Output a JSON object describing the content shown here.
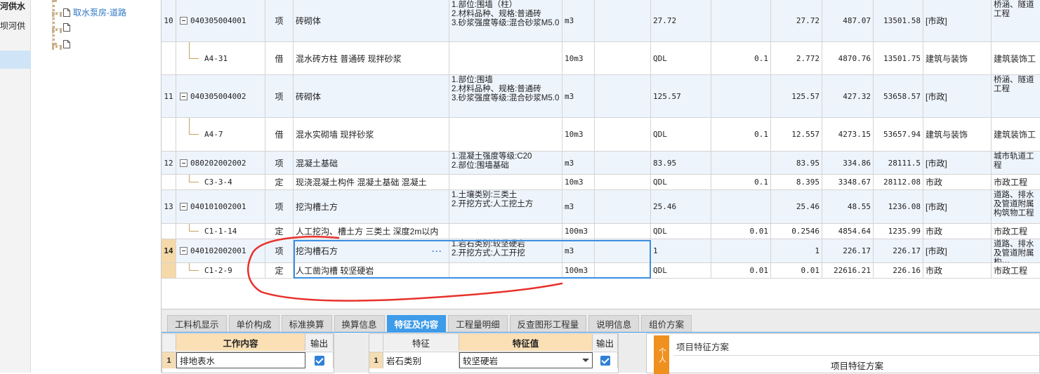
{
  "left_strip": {
    "line1": "河供水",
    "line2": "坝河供"
  },
  "tree": {
    "nodes": [
      {
        "label": "取水泵房-道路"
      },
      {
        "label": ""
      },
      {
        "label": ""
      }
    ]
  },
  "grid": {
    "rows": [
      {
        "kind": "item",
        "seq": "10",
        "code": "040305004001",
        "type": "项",
        "name": "砖砌体",
        "feature": "1.部位:围墙（柱）\n2.材料品种、规格:普通砖\n3.砂浆强度等级:混合砂浆M5.0",
        "unit": "m3",
        "expr": "",
        "qty_expr": "27.72",
        "coef": "",
        "qty": "27.72",
        "price": "487.07",
        "total": "13501.58",
        "major": "[市政]",
        "remark": "桥涵、隧道工程"
      },
      {
        "kind": "sub",
        "seq": "",
        "code": "A4-31",
        "type": "借",
        "name": "混水砖方柱 普通砖 现拌砂浆",
        "feature": "",
        "unit": "10m3",
        "expr": "",
        "qty_expr": "QDL",
        "coef": "0.1",
        "qty": "2.772",
        "price": "4870.76",
        "total": "13501.75",
        "major": "建筑与装饰",
        "remark": "建筑装饰工"
      },
      {
        "kind": "item",
        "seq": "11",
        "code": "040305004002",
        "type": "项",
        "name": "砖砌体",
        "feature": "1.部位:围墙\n2.材料品种、规格:普通砖\n3.砂浆强度等级:混合砂浆M5.0",
        "unit": "m3",
        "expr": "",
        "qty_expr": "125.57",
        "coef": "",
        "qty": "125.57",
        "price": "427.32",
        "total": "53658.57",
        "major": "[市政]",
        "remark": "桥涵、隧道工程"
      },
      {
        "kind": "sub",
        "seq": "",
        "code": "A4-7",
        "type": "借",
        "name": "混水实砌墙 现拌砂浆",
        "feature": "",
        "unit": "10m3",
        "expr": "",
        "qty_expr": "QDL",
        "coef": "0.1",
        "qty": "12.557",
        "price": "4273.15",
        "total": "53657.94",
        "major": "建筑与装饰",
        "remark": "建筑装饰工"
      },
      {
        "kind": "item",
        "seq": "12",
        "code": "080202002002",
        "type": "项",
        "name": "混凝土基础",
        "feature": "1.混凝土强度等级:C20\n2.部位:围墙基础",
        "unit": "m3",
        "expr": "",
        "qty_expr": "83.95",
        "coef": "",
        "qty": "83.95",
        "price": "334.86",
        "total": "28111.5",
        "major": "[市政]",
        "remark": "城市轨道工程"
      },
      {
        "kind": "sub",
        "seq": "",
        "code": "C3-3-4",
        "type": "定",
        "name": "现浇混凝土构件 混凝土基础 混凝土",
        "feature": "",
        "unit": "10m3",
        "expr": "",
        "qty_expr": "QDL",
        "coef": "0.1",
        "qty": "8.395",
        "price": "3348.67",
        "total": "28112.08",
        "major": "市政",
        "remark": "市政工程"
      },
      {
        "kind": "item",
        "seq": "13",
        "code": "040101002001",
        "type": "项",
        "name": "挖沟槽土方",
        "feature": "1.土壤类别:三类土\n2.开挖方式:人工挖土方",
        "unit": "m3",
        "expr": "",
        "qty_expr": "25.46",
        "coef": "",
        "qty": "25.46",
        "price": "48.55",
        "total": "1236.08",
        "major": "[市政]",
        "remark": "道路、排水及管道附属构筑物工程"
      },
      {
        "kind": "sub",
        "seq": "",
        "code": "C1-1-14",
        "type": "定",
        "name": "人工挖沟、槽土方 三类土 深度2m以内",
        "feature": "",
        "unit": "100m3",
        "expr": "",
        "qty_expr": "QDL",
        "coef": "0.01",
        "qty": "0.2546",
        "price": "4854.64",
        "total": "1235.99",
        "major": "市政",
        "remark": "市政工程"
      },
      {
        "kind": "item",
        "seq": "14",
        "code": "040102002001",
        "type": "项",
        "name": "挖沟槽石方",
        "feature": "1.岩石类别:较坚硬岩\n2.开挖方式:人工开挖",
        "unit": "m3",
        "expr": "",
        "qty_expr": "1",
        "coef": "",
        "qty": "1",
        "price": "226.17",
        "total": "226.17",
        "major": "[市政]",
        "remark": "道路、排水及管道附属构···"
      },
      {
        "kind": "sub",
        "seq": "",
        "code": "C1-2-9",
        "type": "定",
        "name": "人工凿沟槽 较坚硬岩",
        "feature": "",
        "unit": "100m3",
        "expr": "",
        "qty_expr": "QDL",
        "coef": "0.01",
        "qty": "0.01",
        "price": "22616.21",
        "total": "226.16",
        "major": "市政",
        "remark": "市政工程"
      }
    ],
    "more_indicator": "···"
  },
  "bottom": {
    "tabs": [
      "工料机显示",
      "单价构成",
      "标准换算",
      "换算信息",
      "特征及内容",
      "工程量明细",
      "反查图形工程量",
      "说明信息",
      "组价方案"
    ],
    "active_tab": "特征及内容",
    "work": {
      "headers": [
        "工作内容",
        "输出"
      ],
      "rows": [
        {
          "idx": "1",
          "content": "排地表水"
        }
      ]
    },
    "feature": {
      "headers": [
        "特征",
        "特征值",
        "输出"
      ],
      "rows": [
        {
          "idx": "1",
          "name": "岩石类别",
          "value": "较坚硬岩"
        }
      ]
    },
    "scheme": {
      "vtab": "个人",
      "title": "项目特征方案",
      "column": "项目特征方案"
    }
  },
  "colors": {
    "accent": "#3d9be9",
    "selection_border": "#3b8ee0",
    "annotation_red": "#e8312b",
    "current_row": "#f6d9a8"
  }
}
